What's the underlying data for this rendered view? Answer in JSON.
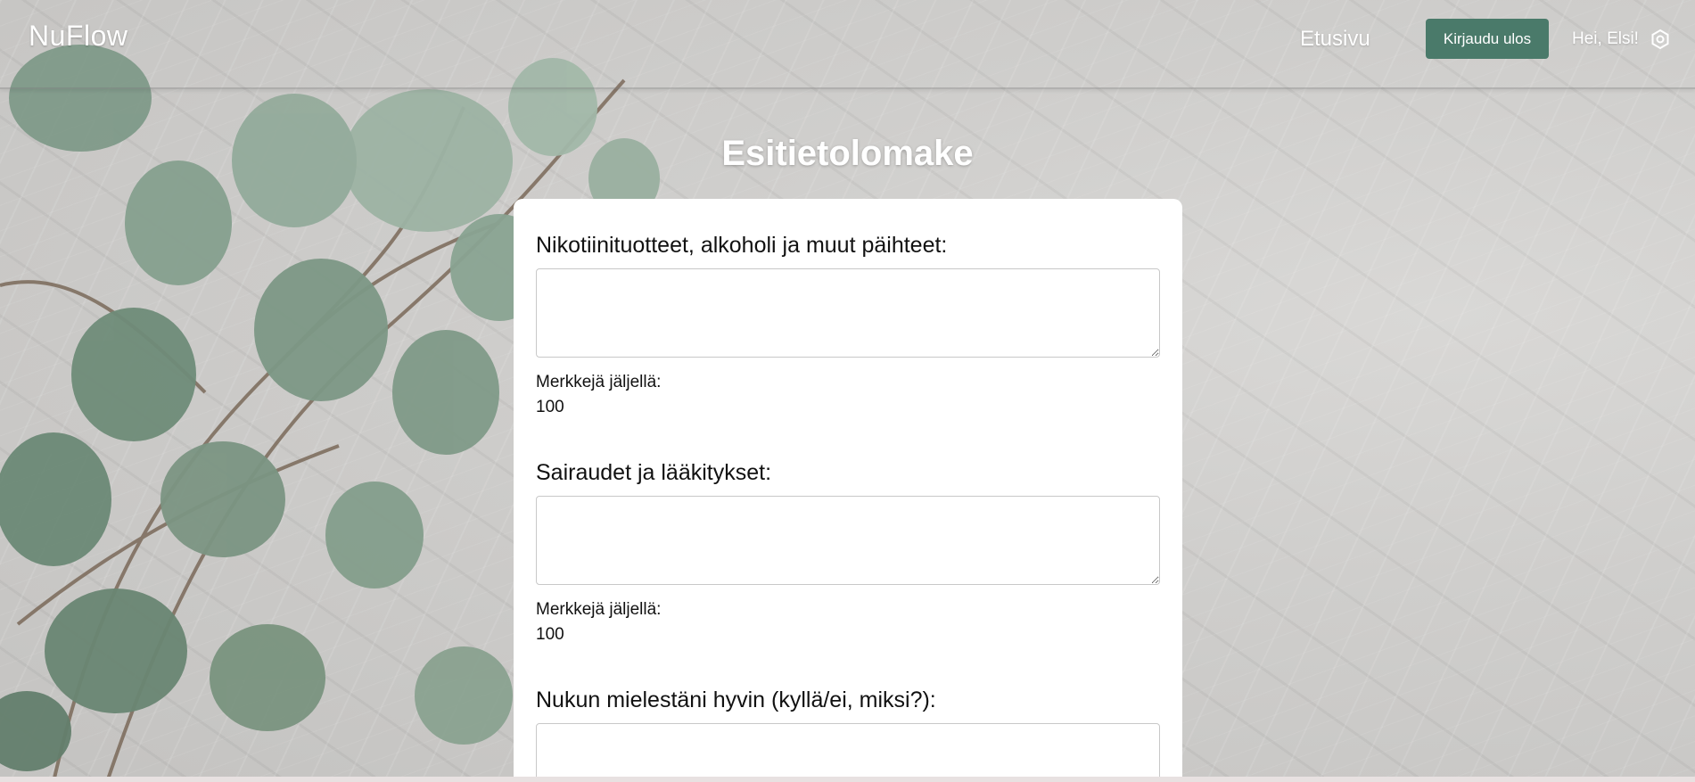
{
  "header": {
    "brand": "NuFlow",
    "nav_home": "Etusivu",
    "logout_label": "Kirjaudu ulos",
    "greeting": "Hei, Elsi!",
    "settings_icon": "gear-icon"
  },
  "page": {
    "title": "Esitietolomake"
  },
  "form": {
    "fields": [
      {
        "label": "Nikotiinituotteet, alkoholi ja muut päihteet:",
        "value": "",
        "counter_label": "Merkkejä jäljellä:",
        "counter_value": "100"
      },
      {
        "label": "Sairaudet ja lääkitykset:",
        "value": "",
        "counter_label": "Merkkejä jäljellä:",
        "counter_value": "100"
      },
      {
        "label": "Nukun mielestäni hyvin (kyllä/ei, miksi?):",
        "value": ""
      }
    ]
  },
  "colors": {
    "accent": "#4a7a6a",
    "card": "#ffffff",
    "background": "#cfcecc"
  }
}
